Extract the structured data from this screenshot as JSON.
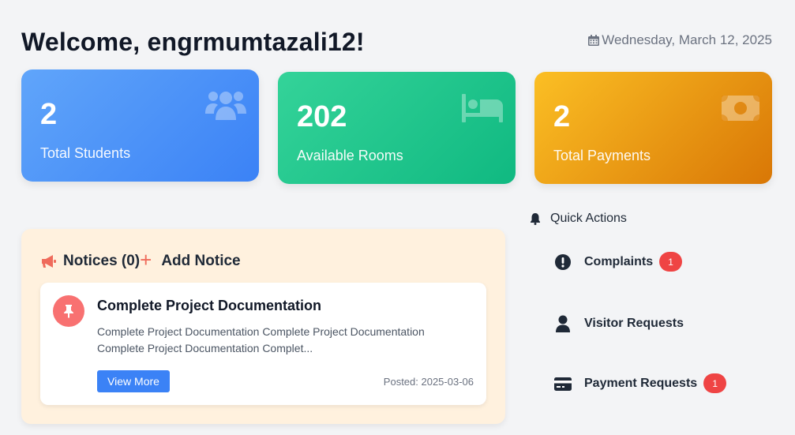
{
  "header": {
    "welcome": "Welcome, engrmumtazali12!",
    "date": "Wednesday, March 12, 2025"
  },
  "stats": {
    "students": {
      "value": "2",
      "label": "Total Students",
      "icon": "users-icon"
    },
    "rooms": {
      "value": "202",
      "label": "Available Rooms",
      "icon": "bed-icon"
    },
    "payments": {
      "value": "2",
      "label": "Total Payments",
      "icon": "money-bill-icon"
    }
  },
  "colors": {
    "students": "#3b82f6",
    "rooms": "#10b981",
    "payments": "#f59e0b",
    "notices_bg": "#fff1de",
    "badge": "#ef4444",
    "button": "#3b82f6"
  },
  "notices": {
    "title": "Notices (0)",
    "add_label": "Add Notice",
    "items": [
      {
        "title": "Complete Project Documentation",
        "body": "Complete Project Documentation Complete Project Documentation Complete Project Documentation Complet...",
        "button": "View More",
        "posted": "Posted: 2025-03-06"
      }
    ]
  },
  "quick_actions": {
    "title": "Quick Actions",
    "items": [
      {
        "label": "Complaints",
        "badge": "1",
        "icon": "exclamation-circle-icon"
      },
      {
        "label": "Visitor Requests",
        "icon": "user-icon"
      },
      {
        "label": "Payment Requests",
        "badge": "1",
        "icon": "credit-card-icon"
      }
    ]
  }
}
